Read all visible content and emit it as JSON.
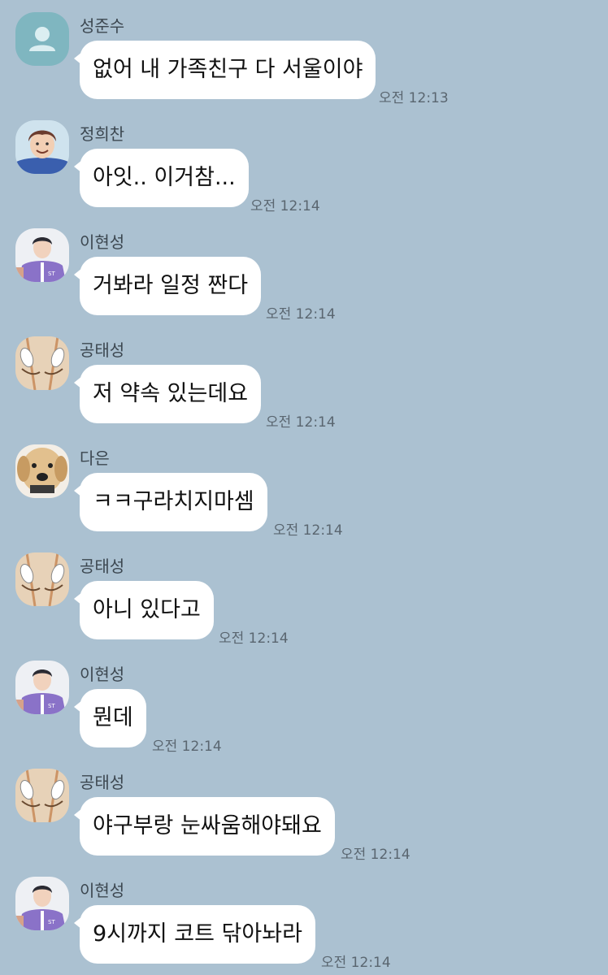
{
  "messages": [
    {
      "sender": "성준수",
      "avatar": "default-profile-icon",
      "text": "없어 내 가족친구 다 서울이야",
      "time": "오전 12:13"
    },
    {
      "sender": "정희찬",
      "avatar": "smiling-boy-avatar-icon",
      "text": "아잇.. 이거참...",
      "time": "오전 12:14"
    },
    {
      "sender": "이현성",
      "avatar": "purple-jersey-avatar-icon",
      "text": "거봐라 일정 짠다",
      "time": "오전 12:14"
    },
    {
      "sender": "공태성",
      "avatar": "sneakers-avatar-icon",
      "text": "저 약속 있는데요",
      "time": "오전 12:14"
    },
    {
      "sender": "다은",
      "avatar": "puppy-avatar-icon",
      "text": "ㅋㅋ구라치지마셈",
      "time": "오전 12:14"
    },
    {
      "sender": "공태성",
      "avatar": "sneakers-avatar-icon",
      "text": "아니 있다고",
      "time": "오전 12:14"
    },
    {
      "sender": "이현성",
      "avatar": "purple-jersey-avatar-icon",
      "text": "뭔데",
      "time": "오전 12:14"
    },
    {
      "sender": "공태성",
      "avatar": "sneakers-avatar-icon",
      "text": "야구부랑 눈싸움해야돼요",
      "time": "오전 12:14"
    },
    {
      "sender": "이현성",
      "avatar": "purple-jersey-avatar-icon",
      "text": "9시까지 코트 닦아놔라",
      "time": "오전 12:14"
    }
  ],
  "colors": {
    "background": "#abc1d1",
    "bubble": "#ffffff",
    "default_avatar": "#7fb6c0"
  }
}
